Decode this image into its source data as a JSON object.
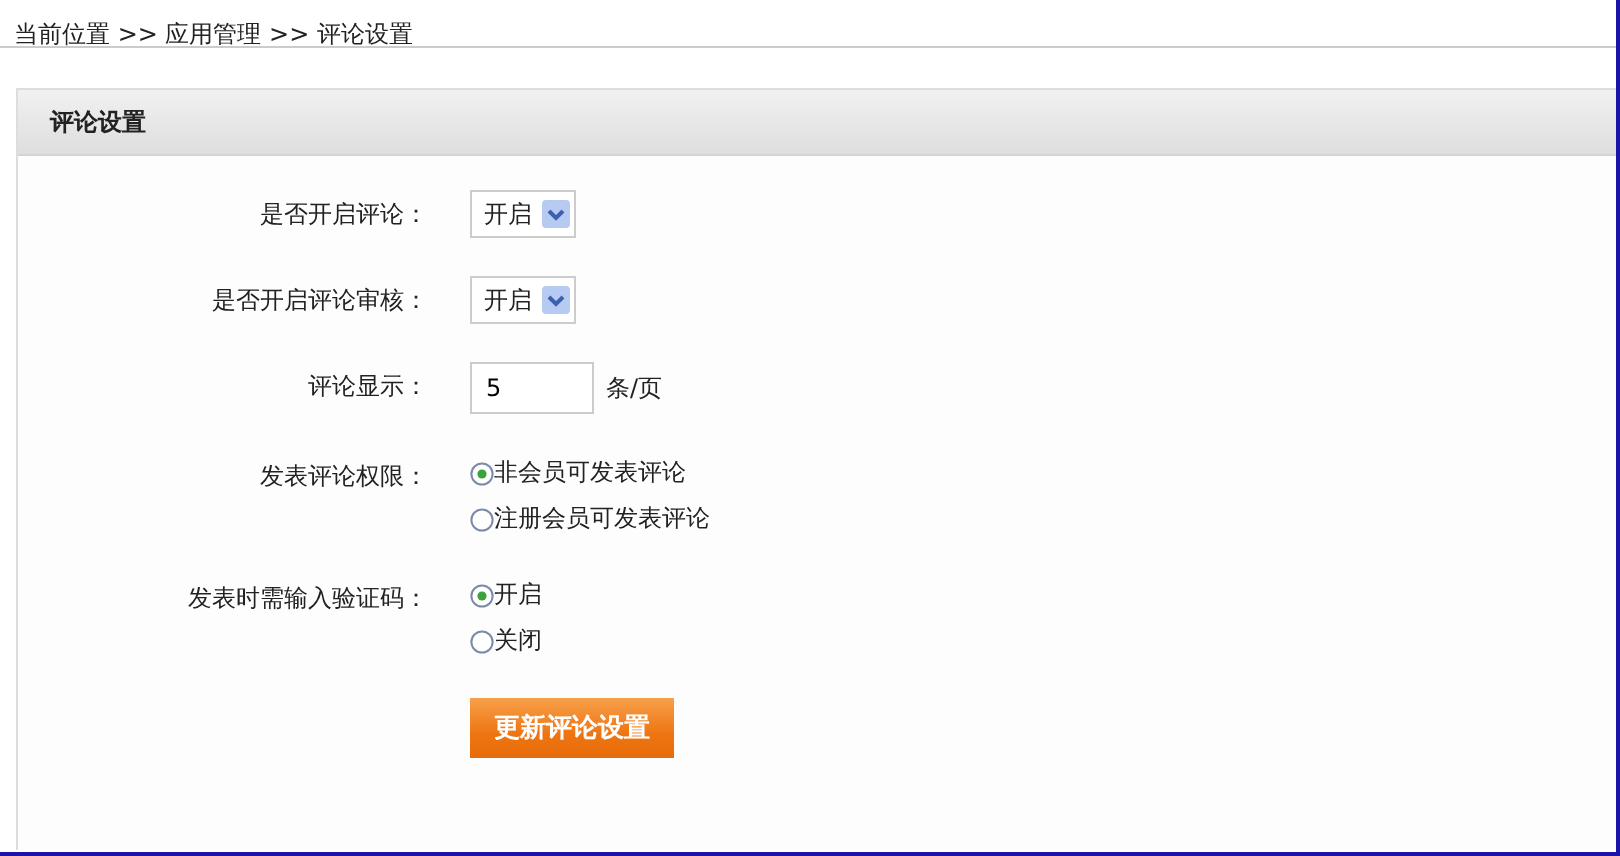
{
  "breadcrumb": "当前位置 >> 应用管理 >> 评论设置",
  "panel": {
    "title": "评论设置",
    "fields": [
      {
        "kind": "select",
        "label": "是否开启评论：",
        "value": "开启"
      },
      {
        "kind": "select",
        "label": "是否开启评论审核：",
        "value": "开启"
      },
      {
        "kind": "text",
        "label": "评论显示：",
        "value": "5",
        "unit": "条/页"
      },
      {
        "kind": "radio",
        "label": "发表评论权限：",
        "options": [
          {
            "label": "非会员可发表评论",
            "selected": true
          },
          {
            "label": "注册会员可发表评论",
            "selected": false
          }
        ]
      },
      {
        "kind": "radio",
        "label": "发表时需输入验证码：",
        "options": [
          {
            "label": "开启",
            "selected": true
          },
          {
            "label": "关闭",
            "selected": false
          }
        ]
      }
    ],
    "button": "更新评论设置"
  }
}
